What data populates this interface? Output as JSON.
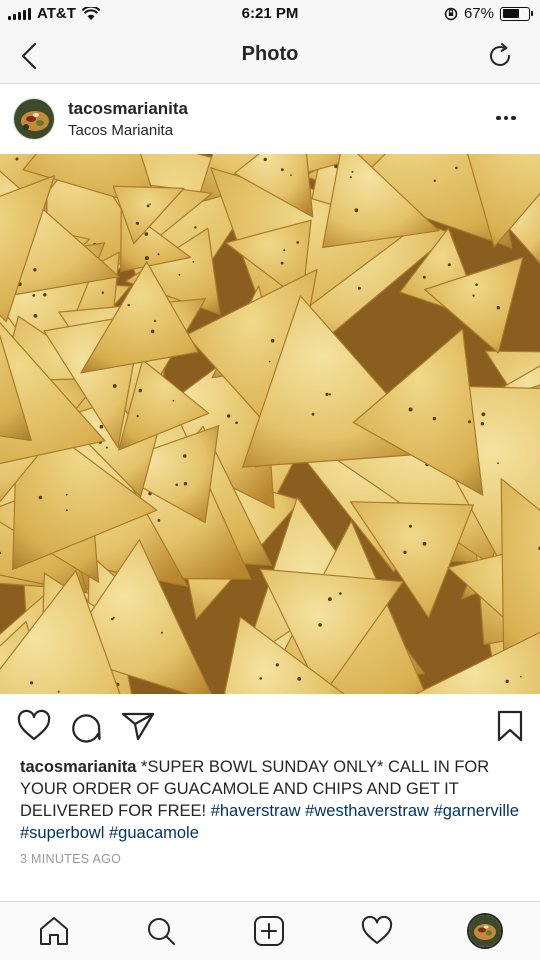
{
  "status_bar": {
    "carrier": "AT&T",
    "time": "6:21 PM",
    "battery_percent": "67%",
    "battery_level": 0.67
  },
  "nav": {
    "title": "Photo",
    "back_icon": "chevron-left-icon",
    "refresh_icon": "refresh-icon"
  },
  "post": {
    "username": "tacosmarianita",
    "location": "Tacos Marianita",
    "photo_subject": "tortilla chips"
  },
  "actions": {
    "like_icon": "heart-icon",
    "comment_icon": "comment-icon",
    "share_icon": "send-icon",
    "save_icon": "bookmark-icon"
  },
  "caption": {
    "username": "tacosmarianita",
    "text": " *SUPER BOWL SUNDAY ONLY* CALL IN FOR YOUR ORDER OF GUACAMOLE AND CHIPS AND GET IT DELIVERED FOR FREE! ",
    "hashtags": [
      "#haverstraw",
      "#westhaverstraw",
      "#garnerville",
      "#superbowl",
      "#guacamole"
    ],
    "timestamp": "3 MINUTES AGO"
  },
  "tab_bar": {
    "items": [
      "home-icon",
      "search-icon",
      "add-post-icon",
      "activity-heart-icon",
      "profile-avatar"
    ]
  },
  "colors": {
    "hashtag": "#003569",
    "text": "#262626",
    "muted": "#999999",
    "chip": "#e6c46a"
  }
}
